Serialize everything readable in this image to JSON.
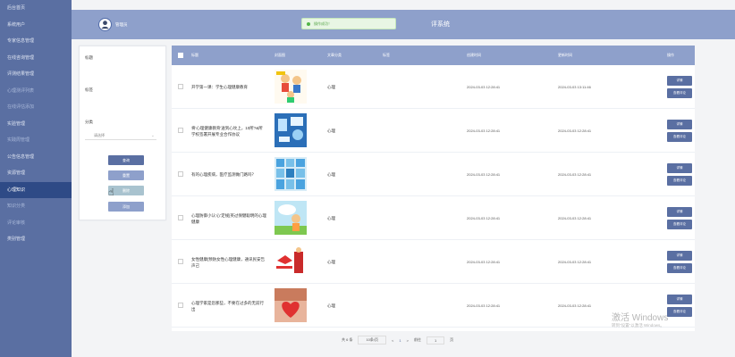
{
  "sidebar": {
    "items": [
      {
        "label": "后台首页",
        "active": false
      },
      {
        "label": "系统用户",
        "active": false
      },
      {
        "label": "专家信息管理",
        "active": false
      },
      {
        "label": "在线咨询管理",
        "active": false
      },
      {
        "label": "评测结果管理",
        "active": false
      },
      {
        "label": "心理测评列表",
        "active": false
      },
      {
        "label": "在线评估添加",
        "active": false
      },
      {
        "label": "实验管理",
        "active": false
      },
      {
        "label": "实践周管理",
        "active": false
      },
      {
        "label": "公告信息管理",
        "active": false
      },
      {
        "label": "资源管理",
        "active": false
      },
      {
        "label": "心理知识",
        "active": true
      },
      {
        "label": "知识分类",
        "active": false
      },
      {
        "label": "评论审核",
        "active": false
      },
      {
        "label": "类别管理",
        "active": false
      }
    ]
  },
  "header": {
    "admin_label": "管理员",
    "system_title": "评系统",
    "toast": "操作成功！"
  },
  "filter": {
    "title_label": "标题",
    "tag_label": "标签",
    "category_label": "分类",
    "category_placeholder": "请选择",
    "query_button": "查询",
    "reset_button": "重置",
    "delete_button": "删除",
    "add_button": "添加"
  },
  "table": {
    "headers": [
      "标题",
      "封面图",
      "文章分类",
      "标签",
      "创建时间",
      "更新时间",
      "操作"
    ],
    "rows": [
      {
        "title": "开学第一课：学生心理健康教育",
        "category": "心理",
        "tag": "",
        "created": "2024-03-03 12:28:41",
        "updated": "2024-03-03 13:11:46",
        "btn1": "详情",
        "btn2": "查看评论",
        "image": "kids"
      },
      {
        "title": "将'心理健康教育'送到心坎上，10所?&所学校签署开展专业合作协议",
        "category": "心理",
        "tag": "",
        "created": "2024-03-03 12:28:41",
        "updated": "2024-03-03 12:28:41",
        "btn1": "详情",
        "btn2": "查看评论",
        "image": "blue"
      },
      {
        "title": "有的心理疾病，医疗监测做门路吗？",
        "category": "心理",
        "tag": "",
        "created": "2024-03-03 12:28:41",
        "updated": "2024-03-03 12:28:41",
        "btn1": "详情",
        "btn2": "查看评论",
        "image": "grid"
      },
      {
        "title": "心理防御小认'心'定规|英过保健聪明的心理健康",
        "category": "心理",
        "tag": "",
        "created": "2024-03-03 12:28:41",
        "updated": "2024-03-03 12:28:41",
        "btn1": "详情",
        "btn2": "查看评论",
        "image": "cartoon"
      },
      {
        "title": "女性健康|预防女性心理健康，通讯民安告声己",
        "category": "心理",
        "tag": "",
        "created": "2024-03-03 12:28:41",
        "updated": "2024-03-03 12:28:41",
        "btn1": "详情",
        "btn2": "查看评论",
        "image": "red"
      },
      {
        "title": "心理学家是您那些，不要在过多的无前行出",
        "category": "心理",
        "tag": "",
        "created": "2024-03-03 12:28:41",
        "updated": "2024-03-03 12:28:41",
        "btn1": "详情",
        "btn2": "查看评论",
        "image": "heart"
      }
    ]
  },
  "pager": {
    "total": "共 6 条",
    "page_size": "10条/页",
    "prev": "<",
    "current": "1",
    "next": ">",
    "goto": "前往",
    "page_input": "1",
    "page_unit": "页"
  },
  "watermark": {
    "line1": "激活 Windows",
    "line2": "转到\"设置\"以激活 Windows。"
  },
  "colors": {
    "sidebar": "#5a6fa2",
    "header": "#8ea0cb",
    "active": "#2e4a86",
    "button": "#5a6fa2"
  }
}
